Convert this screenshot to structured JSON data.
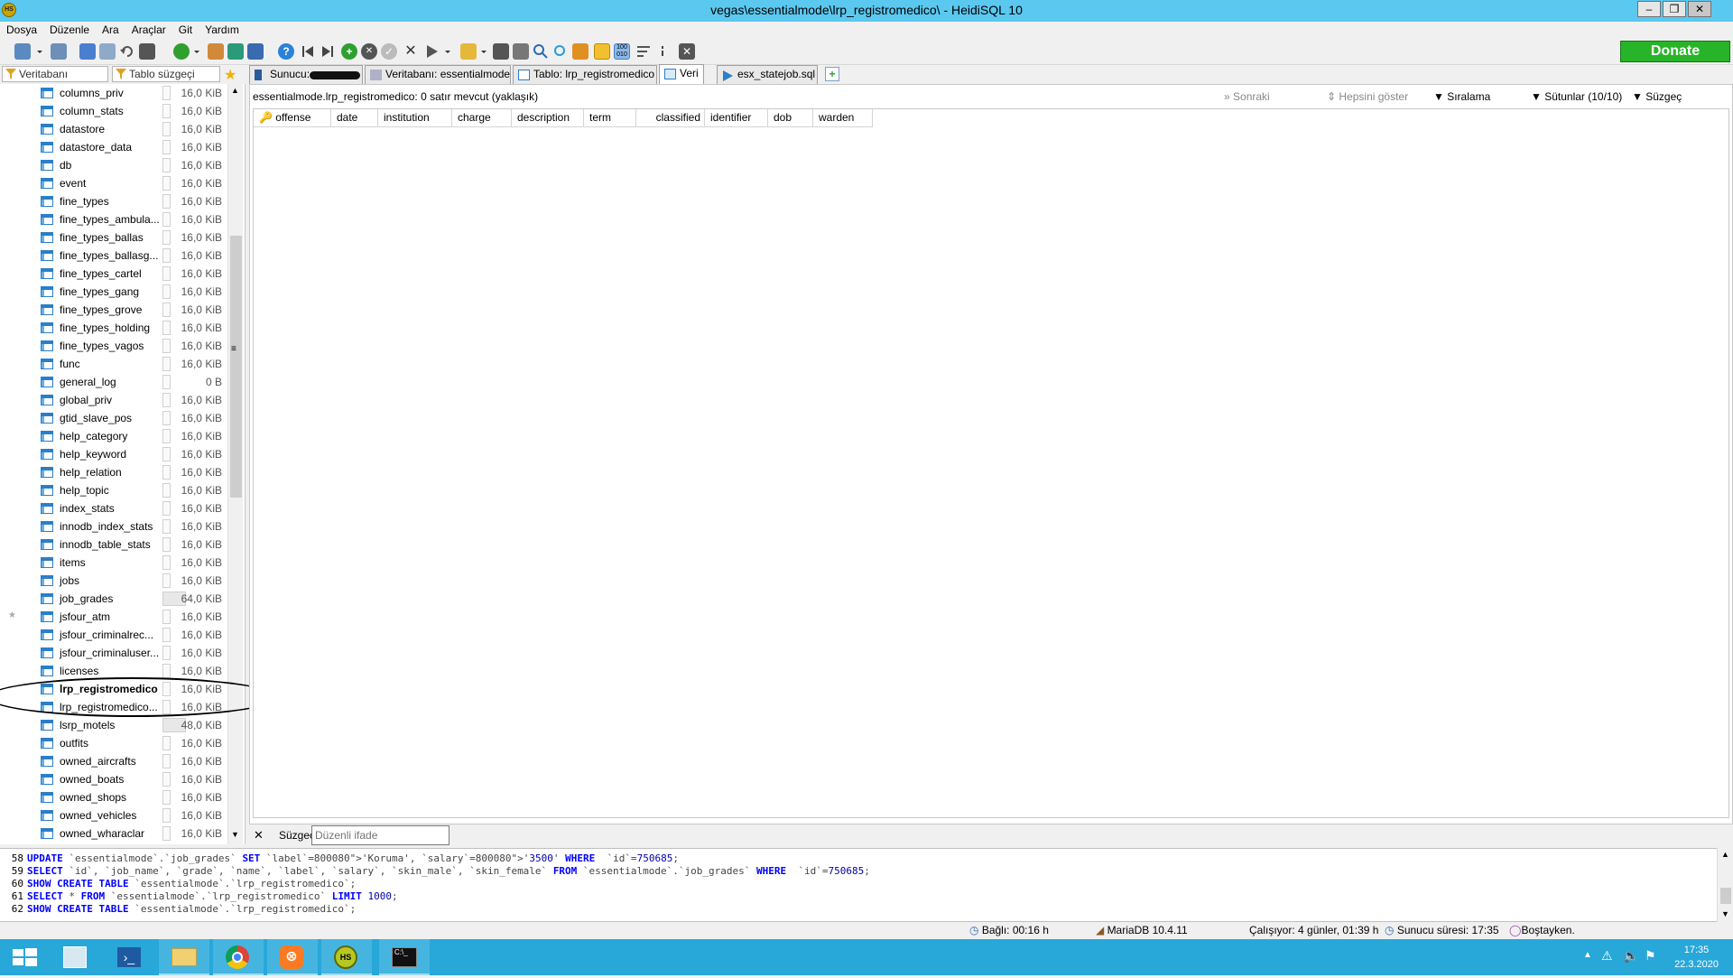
{
  "window": {
    "title": "vegas\\essentialmode\\lrp_registromedico\\ - HeidiSQL 10",
    "min": "–",
    "max": "❐",
    "close": "✕"
  },
  "menu": [
    "Dosya",
    "Düzenle",
    "Ara",
    "Araçlar",
    "Git",
    "Yardım"
  ],
  "toolbar": {
    "donate": "Donate"
  },
  "filters": {
    "db_filter": "Veritabanı süzgeçi",
    "table_filter": "Tablo süzgeçi"
  },
  "tabs": [
    {
      "label": "Sunucu: ",
      "icon": "server-icon"
    },
    {
      "label": "Veritabanı: essentialmode",
      "icon": "database-icon"
    },
    {
      "label": "Tablo: lrp_registromedico",
      "icon": "table-icon"
    },
    {
      "label": "Veri",
      "icon": "grid-icon"
    },
    {
      "label": "esx_statejob.sql",
      "icon": "query-icon"
    }
  ],
  "tables": [
    {
      "name": "columns_priv",
      "size": "16,0 KiB"
    },
    {
      "name": "column_stats",
      "size": "16,0 KiB"
    },
    {
      "name": "datastore",
      "size": "16,0 KiB"
    },
    {
      "name": "datastore_data",
      "size": "16,0 KiB"
    },
    {
      "name": "db",
      "size": "16,0 KiB"
    },
    {
      "name": "event",
      "size": "16,0 KiB"
    },
    {
      "name": "fine_types",
      "size": "16,0 KiB"
    },
    {
      "name": "fine_types_ambula...",
      "size": "16,0 KiB"
    },
    {
      "name": "fine_types_ballas",
      "size": "16,0 KiB"
    },
    {
      "name": "fine_types_ballasg...",
      "size": "16,0 KiB"
    },
    {
      "name": "fine_types_cartel",
      "size": "16,0 KiB"
    },
    {
      "name": "fine_types_gang",
      "size": "16,0 KiB"
    },
    {
      "name": "fine_types_grove",
      "size": "16,0 KiB"
    },
    {
      "name": "fine_types_holding",
      "size": "16,0 KiB"
    },
    {
      "name": "fine_types_vagos",
      "size": "16,0 KiB"
    },
    {
      "name": "func",
      "size": "16,0 KiB"
    },
    {
      "name": "general_log",
      "size": "0 B"
    },
    {
      "name": "global_priv",
      "size": "16,0 KiB"
    },
    {
      "name": "gtid_slave_pos",
      "size": "16,0 KiB"
    },
    {
      "name": "help_category",
      "size": "16,0 KiB"
    },
    {
      "name": "help_keyword",
      "size": "16,0 KiB"
    },
    {
      "name": "help_relation",
      "size": "16,0 KiB"
    },
    {
      "name": "help_topic",
      "size": "16,0 KiB"
    },
    {
      "name": "index_stats",
      "size": "16,0 KiB"
    },
    {
      "name": "innodb_index_stats",
      "size": "16,0 KiB"
    },
    {
      "name": "innodb_table_stats",
      "size": "16,0 KiB"
    },
    {
      "name": "items",
      "size": "16,0 KiB"
    },
    {
      "name": "jobs",
      "size": "16,0 KiB"
    },
    {
      "name": "job_grades",
      "size": "64,0 KiB"
    },
    {
      "name": "jsfour_atm",
      "size": "16,0 KiB"
    },
    {
      "name": "jsfour_criminalrec...",
      "size": "16,0 KiB"
    },
    {
      "name": "jsfour_criminaluser...",
      "size": "16,0 KiB"
    },
    {
      "name": "licenses",
      "size": "16,0 KiB"
    },
    {
      "name": "lrp_registromedico",
      "size": "16,0 KiB"
    },
    {
      "name": "lrp_registromedico...",
      "size": "16,0 KiB"
    },
    {
      "name": "lsrp_motels",
      "size": "48,0 KiB"
    },
    {
      "name": "outfits",
      "size": "16,0 KiB"
    },
    {
      "name": "owned_aircrafts",
      "size": "16,0 KiB"
    },
    {
      "name": "owned_boats",
      "size": "16,0 KiB"
    },
    {
      "name": "owned_shops",
      "size": "16,0 KiB"
    },
    {
      "name": "owned_vehicles",
      "size": "16,0 KiB"
    },
    {
      "name": "owned_wharaclar",
      "size": "16,0 KiB"
    }
  ],
  "data_view": {
    "info": "essentialmode.lrp_registromedico: 0 satır mevcut (yaklaşık)",
    "next": "Sonraki",
    "show_all": "Hepsini göster",
    "sort": "Sıralama",
    "columns": "Sütunlar (10/10)",
    "filter": "Süzgeç",
    "headers": [
      "offense",
      "date",
      "institution",
      "charge",
      "description",
      "term",
      "classified",
      "identifier",
      "dob",
      "warden"
    ]
  },
  "filter_row": {
    "close": "✕",
    "label": "Süzgeç",
    "placeholder": "Düzenli ifade"
  },
  "sql_log": [
    {
      "n": "58",
      "text": "UPDATE `essentialmode`.`job_grades` SET `label`='Koruma', `salary`='3500' WHERE  `id`=750685;"
    },
    {
      "n": "59",
      "text": "SELECT `id`, `job_name`, `grade`, `name`, `label`, `salary`, `skin_male`, `skin_female` FROM `essentialmode`.`job_grades` WHERE  `id`=750685;"
    },
    {
      "n": "60",
      "text": "SHOW CREATE TABLE `essentialmode`.`lrp_registromedico`;"
    },
    {
      "n": "61",
      "text": "SELECT * FROM `essentialmode`.`lrp_registromedico` LIMIT 1000;"
    },
    {
      "n": "62",
      "text": "SHOW CREATE TABLE `essentialmode`.`lrp_registromedico`;"
    }
  ],
  "status": {
    "connected": "Bağlı: 00:16 h",
    "server": "MariaDB 10.4.11",
    "running": "Çalışıyor: 4 günler, 01:39 h",
    "server_time": "Sunucu süresi: 17:35",
    "idle": "Boştayken."
  },
  "clock": {
    "time": "17:35",
    "date": "22.3.2020"
  },
  "colors": {
    "title": "#5bc8ef",
    "taskbar": "#28a7d9",
    "donate": "#28b428",
    "keyword": "#0000ff",
    "string": "#800080"
  }
}
